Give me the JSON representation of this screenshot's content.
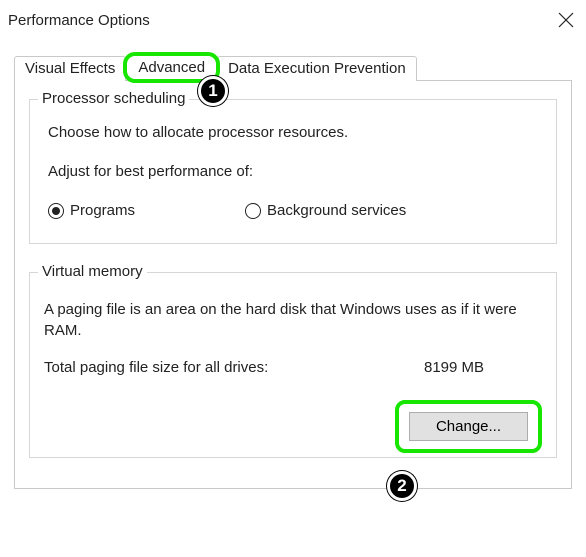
{
  "window": {
    "title": "Performance Options"
  },
  "tabs": {
    "visual_effects": "Visual Effects",
    "advanced": "Advanced",
    "dep": "Data Execution Prevention"
  },
  "processor": {
    "groupTitle": "Processor scheduling",
    "desc": "Choose how to allocate processor resources.",
    "adjustLabel": "Adjust for best performance of:",
    "radioPrograms": "Programs",
    "radioBackground": "Background services"
  },
  "virtualMemory": {
    "groupTitle": "Virtual memory",
    "desc": "A paging file is an area on the hard disk that Windows uses as if it were RAM.",
    "totalLabel": "Total paging file size for all drives:",
    "totalValue": "8199 MB",
    "changeButton": "Change..."
  },
  "annotations": {
    "badge1": "1",
    "badge2": "2"
  }
}
